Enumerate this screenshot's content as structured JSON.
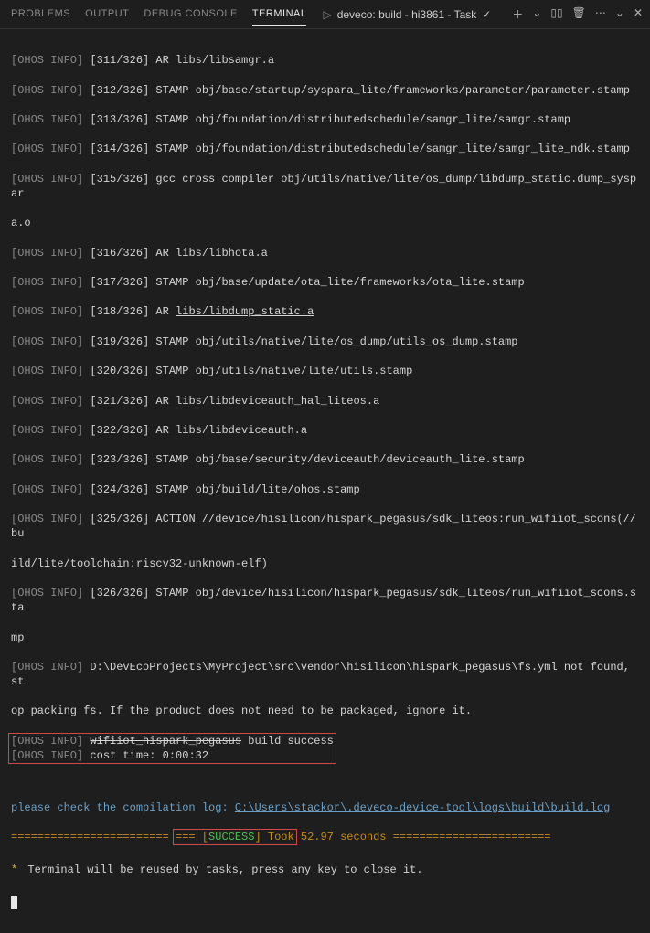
{
  "tabs": {
    "problems": "PROBLEMS",
    "output": "OUTPUT",
    "debug": "DEBUG CONSOLE",
    "terminal": "TERMINAL"
  },
  "task": {
    "chev": "▷",
    "label": "deveco: build - hi3861 - Task",
    "check": "✓"
  },
  "toolbar": {
    "plus": "＋",
    "split": "▯▯",
    "trash": "🗑",
    "dots": "⋯",
    "caret": "⌄",
    "close": "✕"
  },
  "log": {
    "tag": "[OHOS INFO]",
    "l311": "[311/326] AR libs/libsamgr.a",
    "l312": "[312/326] STAMP obj/base/startup/syspara_lite/frameworks/parameter/parameter.stamp",
    "l313": "[313/326] STAMP obj/foundation/distributedschedule/samgr_lite/samgr.stamp",
    "l314": "[314/326] STAMP obj/foundation/distributedschedule/samgr_lite/samgr_lite_ndk.stamp",
    "l315a": "[315/326] gcc cross compiler obj/utils/native/lite/os_dump/libdump_static.dump_syspar",
    "l315b": "a.o",
    "l316": "[316/326] AR libs/libhota.a",
    "l317": "[317/326] STAMP obj/base/update/ota_lite/frameworks/ota_lite.stamp",
    "l318a": "[318/326] AR ",
    "l318b": "libs/libdump_static.a",
    "l319": "[319/326] STAMP obj/utils/native/lite/os_dump/utils_os_dump.stamp",
    "l320": "[320/326] STAMP obj/utils/native/lite/utils.stamp",
    "l321": "[321/326] AR libs/libdeviceauth_hal_liteos.a",
    "l322": "[322/326] AR libs/libdeviceauth.a",
    "l323": "[323/326] STAMP obj/base/security/deviceauth/deviceauth_lite.stamp",
    "l324": "[324/326] STAMP obj/build/lite/ohos.stamp",
    "l325a": "[325/326] ACTION //device/hisilicon/hispark_pegasus/sdk_liteos:run_wifiiot_scons(//bu",
    "l325b": "ild/lite/toolchain:riscv32-unknown-elf)",
    "l326a": "[326/326] STAMP obj/device/hisilicon/hispark_pegasus/sdk_liteos/run_wifiiot_scons.sta",
    "l326b": "mp",
    "path": "D:\\DevEcoProjects\\MyProject\\src\\vendor\\hisilicon\\hispark_pegasus\\fs.yml not found, st",
    "path2": "op packing fs. If the product does not need to be packaged, ignore it.",
    "bs_pref": "wifiiot_hispark_pegasus",
    "bs_suf": " build success",
    "cost": "cost time: 0:00:32",
    "please": "please check the compilation log: ",
    "logpath": "C:\\Users\\stackor\\.deveco-device-tool\\logs\\build\\build.log",
    "eqpre": "======================== ",
    "eqmid1": "=== [",
    "success": "SUCCESS",
    "eqmid2": "] Took",
    "took": " 52.97 seconds ",
    "eqpost": "========================",
    "reuse": "Terminal will be reused by tasks, press any key to close it.",
    "star": "*"
  }
}
